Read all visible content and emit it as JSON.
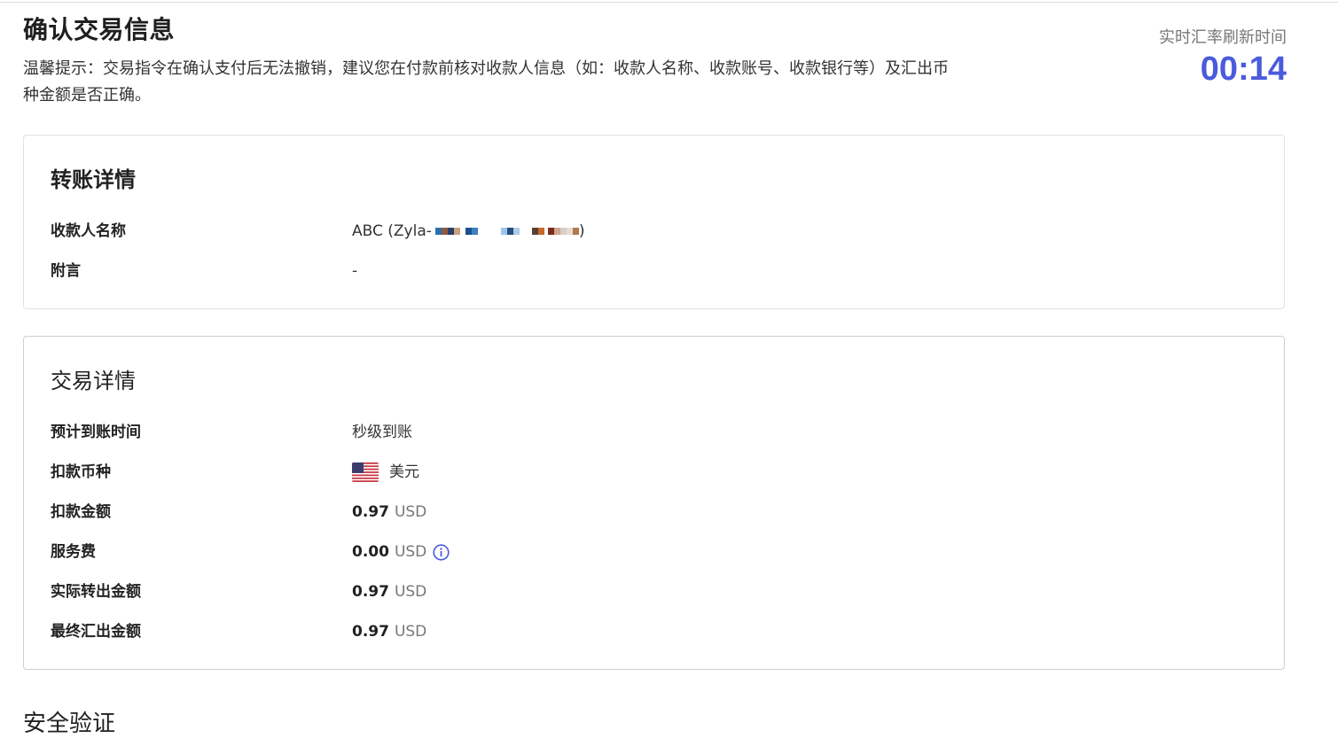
{
  "header": {
    "title": "确认交易信息",
    "notice": "温馨提示：交易指令在确认支付后无法撤销，建议您在付款前核对收款人信息（如：收款人名称、收款账号、收款银行等）及汇出币种金额是否正确。"
  },
  "timer": {
    "label": "实时汇率刷新时间",
    "value": "00:14"
  },
  "transfer": {
    "title": "转账详情",
    "rows": [
      {
        "label": "收款人名称",
        "value_prefix": "ABC (Zyla-",
        "value_suffix": ")"
      },
      {
        "label": "附言",
        "value": "-"
      }
    ]
  },
  "trade": {
    "title": "交易详情",
    "arrival": {
      "label": "预计到账时间",
      "value": "秒级到账"
    },
    "currency": {
      "label": "扣款币种",
      "value": "美元",
      "flag_icon": "us-flag-icon"
    },
    "debit": {
      "label": "扣款金额",
      "amount": "0.97",
      "unit": "USD"
    },
    "fee": {
      "label": "服务费",
      "amount": "0.00",
      "unit": "USD",
      "icon": "info-icon"
    },
    "actual": {
      "label": "实际转出金额",
      "amount": "0.97",
      "unit": "USD"
    },
    "final": {
      "label": "最终汇出金额",
      "amount": "0.97",
      "unit": "USD"
    }
  },
  "security": {
    "title": "安全验证"
  },
  "colors": {
    "accent": "#4a5bdc",
    "text": "#222222",
    "muted": "#777777",
    "border": "#e2e2e2"
  }
}
